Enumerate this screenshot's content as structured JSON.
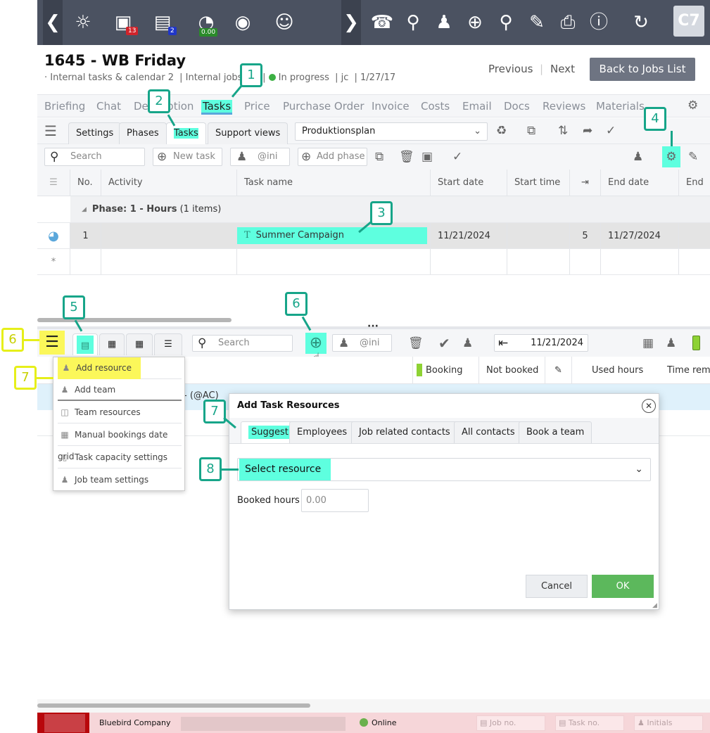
{
  "topbar": {
    "badges": {
      "inbox": "13",
      "clipboard": "2",
      "timer": "0.00"
    },
    "user_badge": "C7",
    "icons": [
      "back-arrow",
      "compass",
      "inbox",
      "clipboard",
      "pie-timer",
      "target",
      "masks",
      "forward-arrow",
      "bell",
      "location-pin",
      "people",
      "add-search",
      "search",
      "edit-form",
      "print",
      "help",
      "refresh"
    ]
  },
  "job": {
    "title": "1645 - WB Friday",
    "meta": [
      "· Internal tasks & calendar 2",
      "Internal jobs",
      "I",
      "In progress",
      "jc",
      "1/27/17"
    ],
    "status_color": "#3cb043"
  },
  "nav": {
    "previous": "Previous",
    "next": "Next",
    "back": "Back to Jobs List"
  },
  "tabs": [
    "Briefing",
    "Chat",
    "Description",
    "Tasks",
    "Price",
    "Purchase Order",
    "Invoice",
    "Costs",
    "Email",
    "Docs",
    "Reviews",
    "Materials"
  ],
  "active_tab": "Tasks",
  "subtabs": [
    "Settings",
    "Phases",
    "Tasks",
    "Support views"
  ],
  "view_select": "Produktionsplan",
  "toolbar": {
    "search_placeholder": "Search",
    "new_task": "New task",
    "initials": "@ini",
    "add_phase": "Add phase"
  },
  "grid": {
    "columns": [
      "No.",
      "Activity",
      "Task name",
      "Start date",
      "Start time",
      "",
      "End date",
      "End ti"
    ],
    "phase_row": {
      "label": "Phase: 1 - Hours",
      "count": "(1 items)"
    },
    "rows": [
      {
        "no": "1",
        "activity": "",
        "task_name": "Summer Campaign",
        "start_date": "11/21/2024",
        "start_time": "",
        "duration": "5",
        "end_date": "11/27/2024"
      }
    ],
    "new_row_marker": "*"
  },
  "lower": {
    "search_placeholder": "Search",
    "initials": "@ini",
    "date": "11/21/2024",
    "columns": [
      "Booking",
      "Not booked",
      "",
      "Used hours",
      "Time rema"
    ],
    "row_text": "- (@AC)"
  },
  "menu": [
    "Add resource",
    "Add team",
    "Team resources",
    "Manual bookings date grid",
    "Task capacity settings",
    "Job team settings"
  ],
  "dialog": {
    "title": "Add Task Resources",
    "tabs": [
      "Suggest",
      "Employees",
      "Job related contacts",
      "All contacts",
      "Book a team"
    ],
    "select_placeholder": "Select resource",
    "booked_hours_label": "Booked hours",
    "booked_hours_value": "0.00",
    "cancel": "Cancel",
    "ok": "OK"
  },
  "callouts": {
    "c1": "1",
    "c2": "2",
    "c3": "3",
    "c4": "4",
    "c5": "5",
    "c6a": "6",
    "c6b": "6",
    "c7a": "7",
    "c7b": "7",
    "c8": "8"
  },
  "status": {
    "company": "Bluebird Company",
    "online": "Online",
    "job_no": "Job no.",
    "task_no": "Task no.",
    "initials": "Initials"
  },
  "colors": {
    "highlight": "#5effdf",
    "highlight_yellow": "#fbf75a",
    "callout": "#17a589",
    "ok": "#5cb85c",
    "status_bar": "#f6d6d9"
  }
}
